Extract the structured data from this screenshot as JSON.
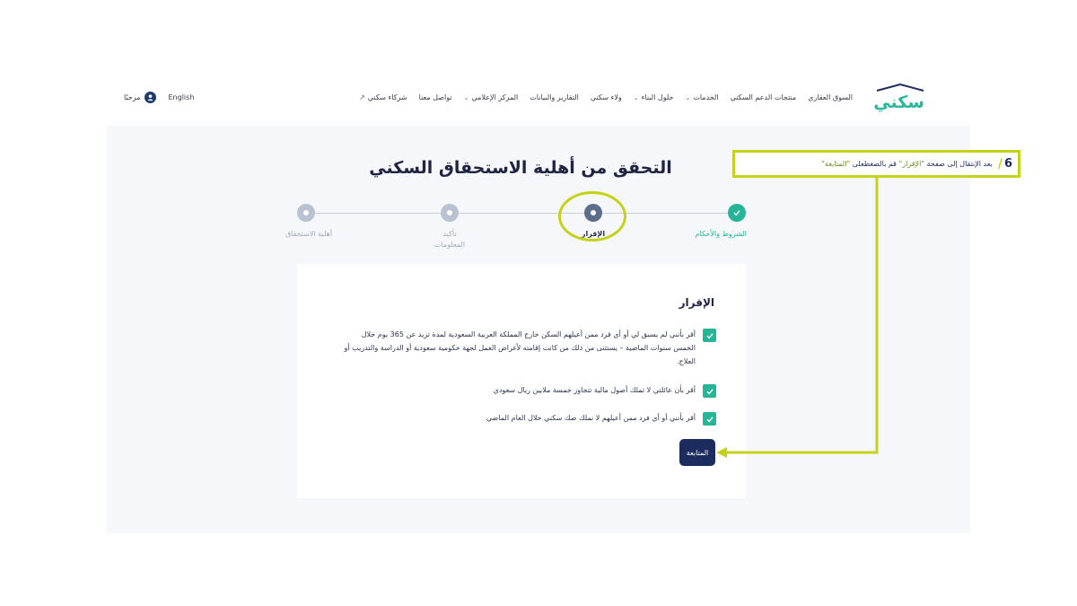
{
  "header": {
    "logo_text": "سكني",
    "nav": [
      {
        "label": "السوق العقاري",
        "dropdown": false
      },
      {
        "label": "منتجات الدعم السكني",
        "dropdown": false
      },
      {
        "label": "الخدمات",
        "dropdown": true
      },
      {
        "label": "حلول البناء",
        "dropdown": true
      },
      {
        "label": "ولاء سكني",
        "dropdown": false
      },
      {
        "label": "التقارير والبيانات",
        "dropdown": false
      },
      {
        "label": "المركز الإعلامي",
        "dropdown": true
      },
      {
        "label": "تواصل معنا",
        "dropdown": false
      },
      {
        "label": "شركاء سكني",
        "dropdown": false
      }
    ],
    "hello": "مرحبًا",
    "language": "English"
  },
  "page": {
    "title": "التحقق من أهلية الاستحقاق السكني"
  },
  "steps": [
    {
      "label": "الشروط والأحكام",
      "state": "done"
    },
    {
      "label": "الإقرار",
      "state": "active"
    },
    {
      "label": "تأكيد المعلومات",
      "state": "pending"
    },
    {
      "label": "أهلية الاستحقاق",
      "state": "pending"
    }
  ],
  "declaration": {
    "title": "الإقرار",
    "items": [
      {
        "text": "أقر بأنني لم يسبق لي أو أي فرد ممن أعيلهم السكن خارج المملكة العربية السعودية لمدة تزيد عن 365 يوم خلال الخمس سنوات الماضية – يستثنى من ذلك من كانت إقامته لأغراض العمل لجهة حكومية سعودية أو الدراسة والتدريب أو العلاج.",
        "checked": true
      },
      {
        "text": "أقر بأن عائلتي لا تملك أصول مالية تتجاوز خمسة ملايين ريال سعودي",
        "checked": true
      },
      {
        "text": "أقر بأنني أو أي فرد ممن أعيلهم لا نملك صك سكني خلال العام الماضي",
        "checked": true
      }
    ],
    "continue_label": "المتابعة"
  },
  "annotation": {
    "number": "6",
    "text_before": "بعد الإنتقال إلى صفحة ",
    "page_name": "\"الإقرار\"",
    "text_middle": " قم بالضغطعلى ",
    "button_name": "\"المتابعة\""
  },
  "colors": {
    "brand_green": "#26b597",
    "navy": "#1c2c5e",
    "annotation_yellow": "#c5d21a"
  }
}
